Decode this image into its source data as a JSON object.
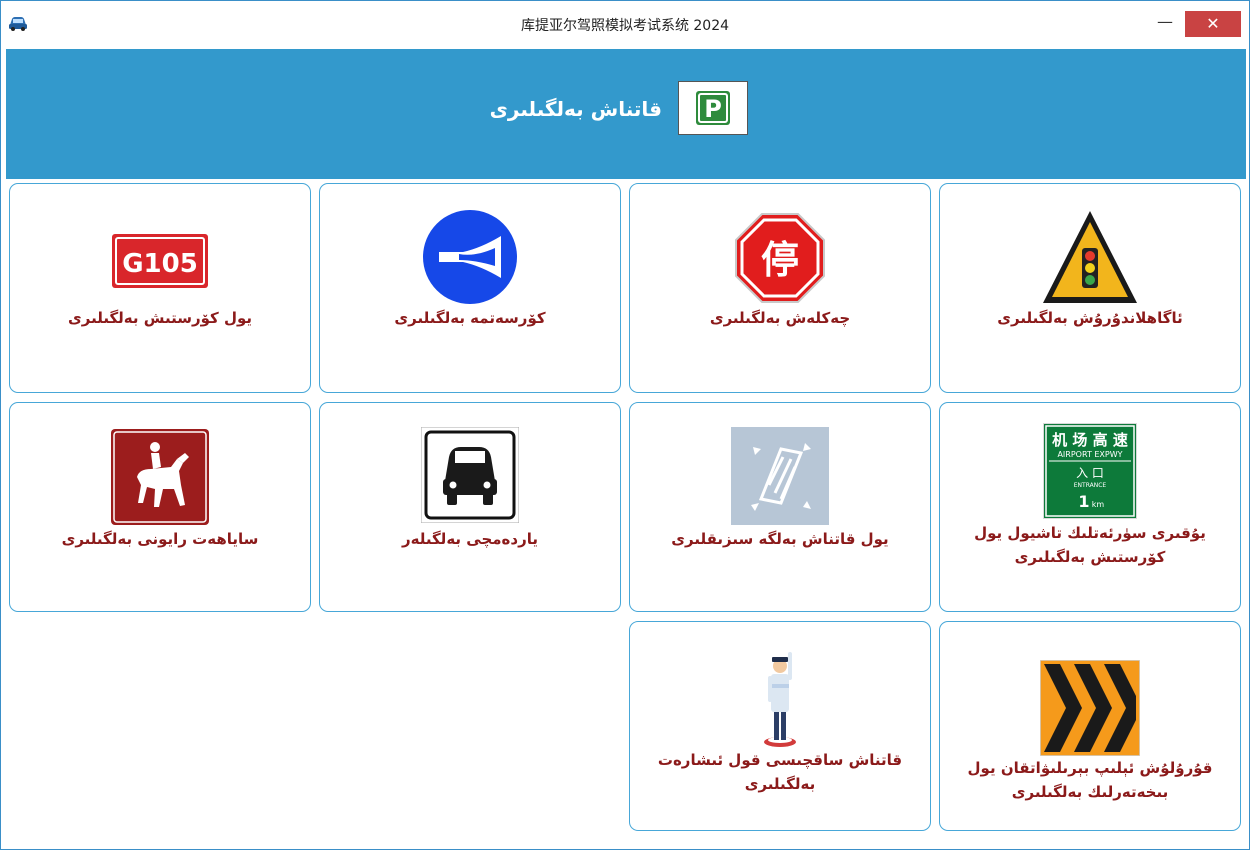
{
  "window": {
    "title": "库提亚尔驾照模拟考试系统 2024",
    "minimize_glyph": "—",
    "close_glyph": "✕"
  },
  "banner": {
    "title": "قاتناش بەلگىلىرى",
    "icon_letter": "P",
    "icon": "parking-sign-icon"
  },
  "categories": [
    {
      "label": "ئاگاھلاندۇرۇش بەلگىلىرى",
      "icon": "traffic-light-warning-icon"
    },
    {
      "label": "چەكلەش بەلگىلىرى",
      "icon": "stop-sign-icon",
      "icon_text": "停"
    },
    {
      "label": "كۆرسەتمە بەلگىلىرى",
      "icon": "horn-sign-icon"
    },
    {
      "label": "يول كۆرستىش بەلگىلىرى",
      "icon": "road-number-sign-icon",
      "icon_text": "G105"
    },
    {
      "label": "يۇقىرى سۈرئەتلىك تاشيول يول كۆرستىش بەلگىلىرى",
      "icon": "expressway-sign-icon",
      "icon_lines": [
        "机 场 高 速",
        "AIRPORT EXPWY",
        "入 口",
        "ENTRANCE",
        "1",
        "km"
      ]
    },
    {
      "label": "يول قاتناش بەلگە سىزىقلىرى",
      "icon": "road-marking-icon"
    },
    {
      "label": "ياردەمچى بەلگىلەر",
      "icon": "car-auxiliary-sign-icon"
    },
    {
      "label": "ساياھەت رايونى بەلگىلىرى",
      "icon": "horse-riding-sign-icon"
    },
    {
      "label": "قاتناش ساقچىسى قول ئىشارەت بەلگىلىرى",
      "icon": "traffic-police-icon"
    },
    {
      "label": "قۇرۇلۇش ئېلىپ بېرىلىۋاتقان يول بىخەتەرلىك بەلگىلىرى",
      "icon": "construction-chevron-icon"
    }
  ],
  "colors": {
    "banner_bg": "#3399cc",
    "card_border": "#47a7d8",
    "label_text": "#8b1a1a",
    "close_button": "#c94343"
  }
}
